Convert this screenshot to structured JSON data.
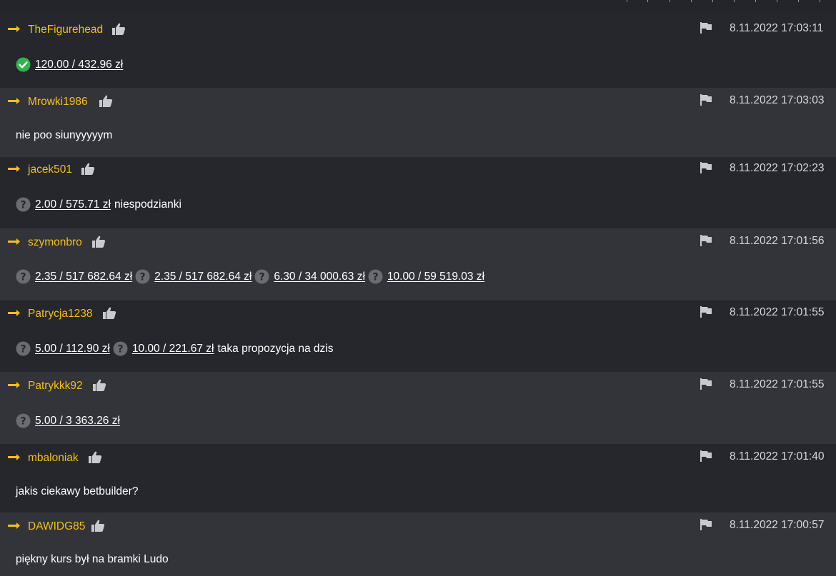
{
  "comments": [
    {
      "username": "TheFigurehead",
      "timestamp": "8.11.2022 17:03:11",
      "status": "won",
      "bets": [
        {
          "text": "120.00 / 432.96 zł"
        }
      ],
      "text": ""
    },
    {
      "username": "Mrowki1986",
      "timestamp": "8.11.2022 17:03:03",
      "text": "nie poo siunyyyyym"
    },
    {
      "username": "jacek501",
      "timestamp": "8.11.2022 17:02:23",
      "bets": [
        {
          "text": "2.00 / 575.71 zł"
        }
      ],
      "text": "niespodzianki"
    },
    {
      "username": "szymonbro",
      "timestamp": "8.11.2022 17:01:56",
      "bets": [
        {
          "text": "2.35 / 517 682.64 zł"
        },
        {
          "text": "2.35 / 517 682.64 zł"
        },
        {
          "text": "6.30 / 34 000.63 zł"
        },
        {
          "text": "10.00 / 59 519.03 zł"
        }
      ],
      "text": ""
    },
    {
      "username": "Patrycja1238",
      "timestamp": "8.11.2022 17:01:55",
      "bets": [
        {
          "text": "5.00 / 112.90 zł"
        },
        {
          "text": "10.00 / 221.67 zł"
        }
      ],
      "text": "taka propozycja na dzis"
    },
    {
      "username": "Patrykkk92",
      "timestamp": "8.11.2022 17:01:55",
      "bets": [
        {
          "text": "5.00 / 3 363.26 zł"
        }
      ],
      "text": ""
    },
    {
      "username": "mbaloniak",
      "timestamp": "8.11.2022 17:01:40",
      "text": "jakis ciekawy betbuilder?"
    },
    {
      "username": "DAWIDG85",
      "timestamp": "8.11.2022 17:00:57",
      "text": "piękny kurs był na bramki Ludo"
    }
  ],
  "colors": {
    "accent": "#f2c01a",
    "won": "#2fb34a",
    "pending": "#6b6b70",
    "row_dark": "#26262d",
    "row_light": "#33333a"
  },
  "icons": {
    "reply": "reply-arrow-icon",
    "like": "thumbs-up-icon",
    "flag": "flag-icon",
    "won": "check-circle-icon",
    "pending": "question-circle-icon"
  }
}
